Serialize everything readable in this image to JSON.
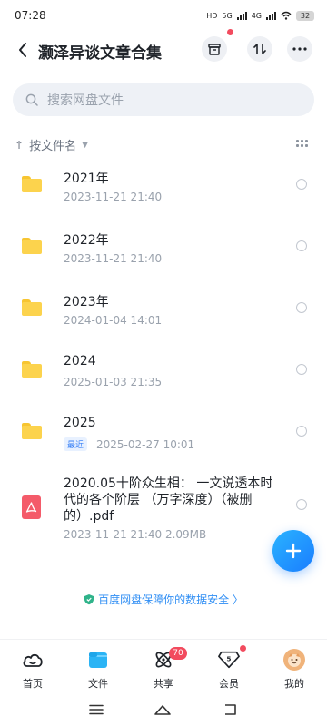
{
  "status_bar": {
    "time": "07:28",
    "hd": "HD",
    "net1": "5G",
    "net2": "4G",
    "battery": "32"
  },
  "header": {
    "title": "灏泽异谈文章合集"
  },
  "search": {
    "placeholder": "搜索网盘文件"
  },
  "sort": {
    "label": "按文件名"
  },
  "files": [
    {
      "name": "2021年",
      "date": "2023-11-21  21:40",
      "badge": ""
    },
    {
      "name": "2022年",
      "date": "2023-11-21  21:40",
      "badge": ""
    },
    {
      "name": "2023年",
      "date": "2024-01-04  14:01",
      "badge": ""
    },
    {
      "name": "2024",
      "date": "2025-01-03  21:35",
      "badge": ""
    },
    {
      "name": "2025",
      "date": "2025-02-27  10:01",
      "badge": "最近"
    }
  ],
  "pdf_file": {
    "name": "2020.05十阶众生相：  一文说透本时代的各个阶层 （万字深度）（被删的）.pdf",
    "meta": "2023-11-21  21:40  2.09MB"
  },
  "security_banner": {
    "text": "百度网盘保障你的数据安全 〉"
  },
  "bottom_nav": {
    "items": [
      {
        "label": "首页",
        "icon": "cloud-icon"
      },
      {
        "label": "文件",
        "icon": "folder-icon"
      },
      {
        "label": "共享",
        "icon": "share-icon"
      },
      {
        "label": "会员",
        "icon": "vip-icon"
      },
      {
        "label": "我的",
        "icon": "avatar-icon"
      }
    ],
    "share_badge": "70",
    "vip_level": "5"
  },
  "colors": {
    "accent": "#1a7dff",
    "folder": "#fcd34d",
    "pdf": "#f45b6a",
    "badge": "#f24b5e"
  }
}
